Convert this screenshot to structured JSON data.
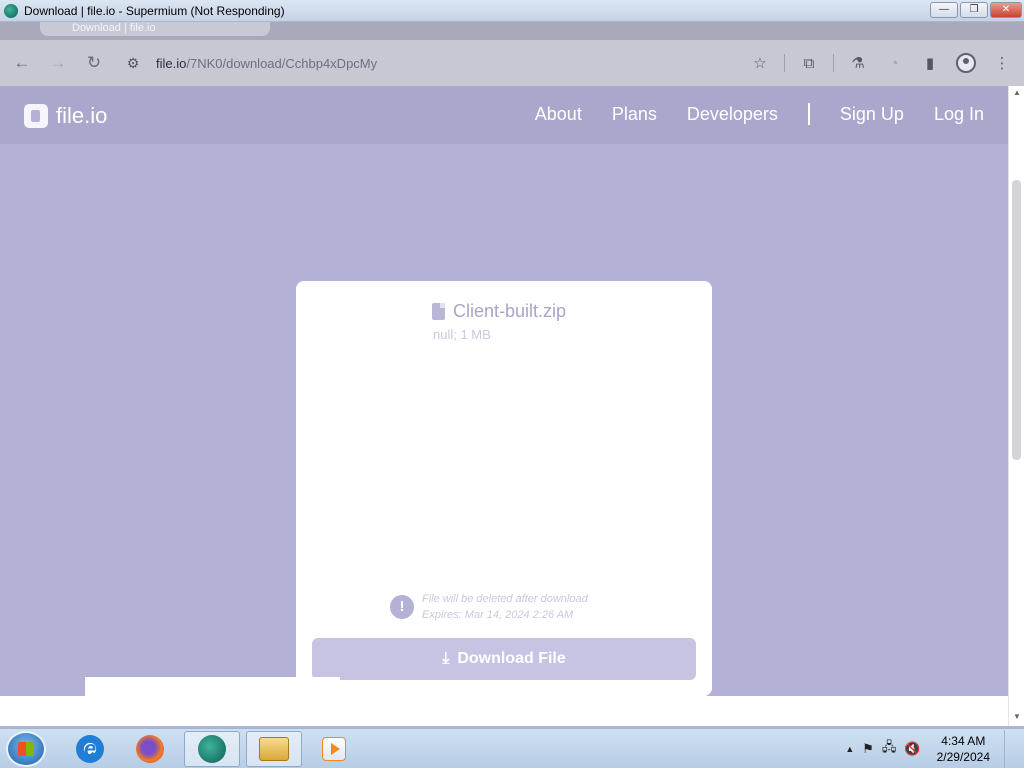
{
  "window": {
    "title": "Download | file.io - Supermium (Not Responding)",
    "minimize": "—",
    "maximize": "❐",
    "close": "✕"
  },
  "tab": {
    "label": "Download | file.io"
  },
  "browser": {
    "url_host": "file.io",
    "url_path": "/7NK0/download/Cchbp4xDpcMy",
    "back": "←",
    "forward": "→",
    "reload": "↻"
  },
  "site": {
    "logo": "file.io",
    "nav": [
      "About",
      "Plans",
      "Developers",
      "Sign Up",
      "Log In"
    ]
  },
  "file": {
    "name": "Client-built.zip",
    "meta": "null; 1 MB",
    "notice_line1": "File will be deleted after download",
    "notice_line2": "Expires: Mar 14, 2024 2:26 AM",
    "notice_icon": "!",
    "download_label": "Download File"
  },
  "taskbar": {
    "time": "4:34 AM",
    "date": "2/29/2024",
    "tray_up": "▲",
    "flag": "⚑"
  },
  "colors": {
    "page_bg": "#b3b1d6",
    "header_bg": "#a9a7cb",
    "button_bg": "#c6c4e2"
  }
}
